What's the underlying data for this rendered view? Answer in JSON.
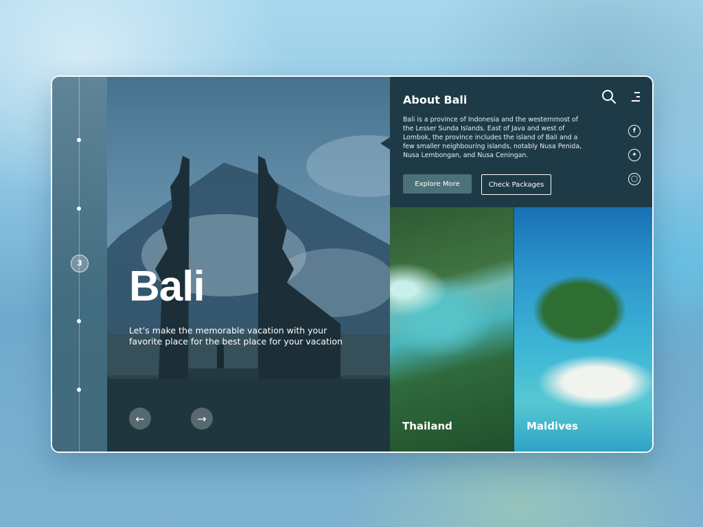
{
  "timeline": {
    "current_index": "3"
  },
  "hero": {
    "title": "Bali",
    "subtitle": "Let’s make the memorable vacation with your favorite place for the best place for your vacation",
    "prev_icon": "arrow-left-icon",
    "next_icon": "arrow-right-icon"
  },
  "about": {
    "title": "About Bali",
    "text": "Bali is a province of Indonesia and the westernmost of the Lesser Sunda Islands. East of Java and west of Lombok, the province includes the island of Bali and a few smaller neighbouring islands, notably Nusa Penida, Nusa Lembongan, and Nusa Ceningan.",
    "explore_label": "Explore More",
    "packages_label": "Check Packages"
  },
  "header_icons": [
    "search-icon",
    "menu-icon"
  ],
  "social": [
    "facebook-icon",
    "twitter-icon",
    "instagram-icon"
  ],
  "destinations": [
    {
      "label": "Thailand"
    },
    {
      "label": "Maldives"
    }
  ],
  "colors": {
    "panel": "#1e3a47",
    "explore_button": "#4b7278",
    "text": "#ffffff"
  }
}
